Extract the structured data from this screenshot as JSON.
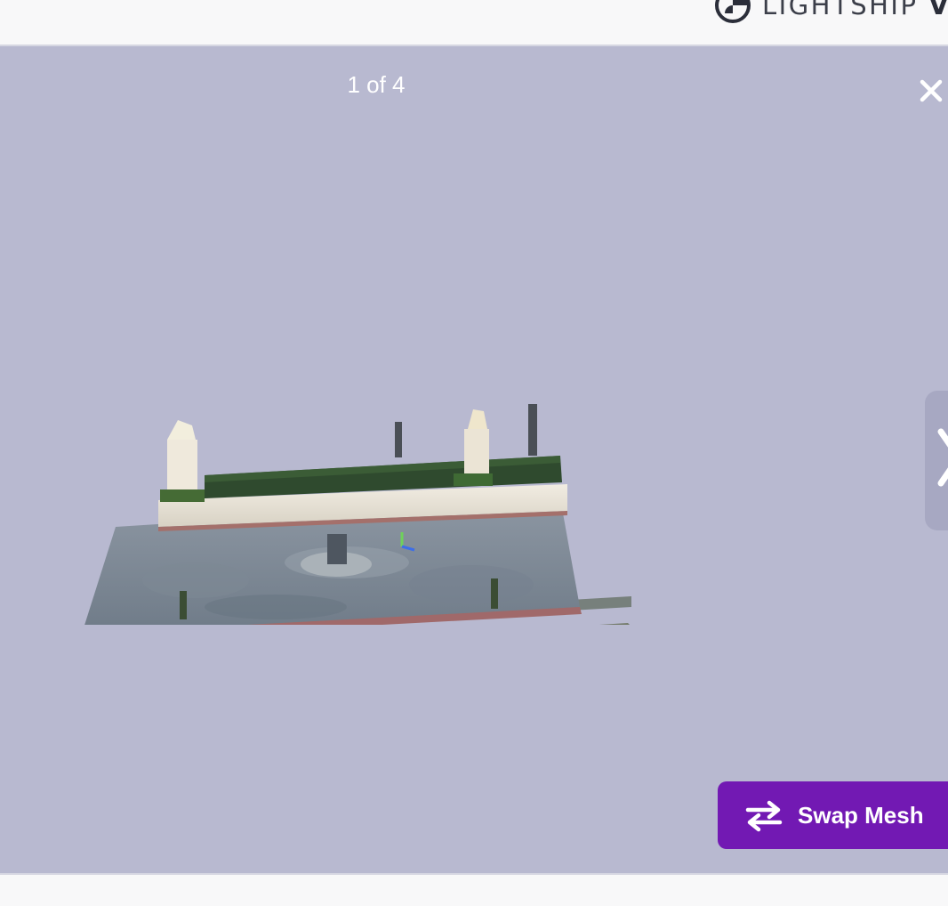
{
  "header": {
    "brand_prefix": "LIGHTSHIP",
    "brand_suffix": "V",
    "logo_icon": "lightship-logo-icon"
  },
  "viewer": {
    "counter_text": "1 of 4",
    "background_color": "#b8b9d0",
    "close_icon": "close-icon",
    "next_icon": "chevron-right-icon",
    "scene_description_icon": "mesh-point-cloud"
  },
  "actions": {
    "swap_label": "Swap Mesh",
    "swap_icon": "swap-arrows-icon",
    "swap_color": "#7219b3"
  }
}
